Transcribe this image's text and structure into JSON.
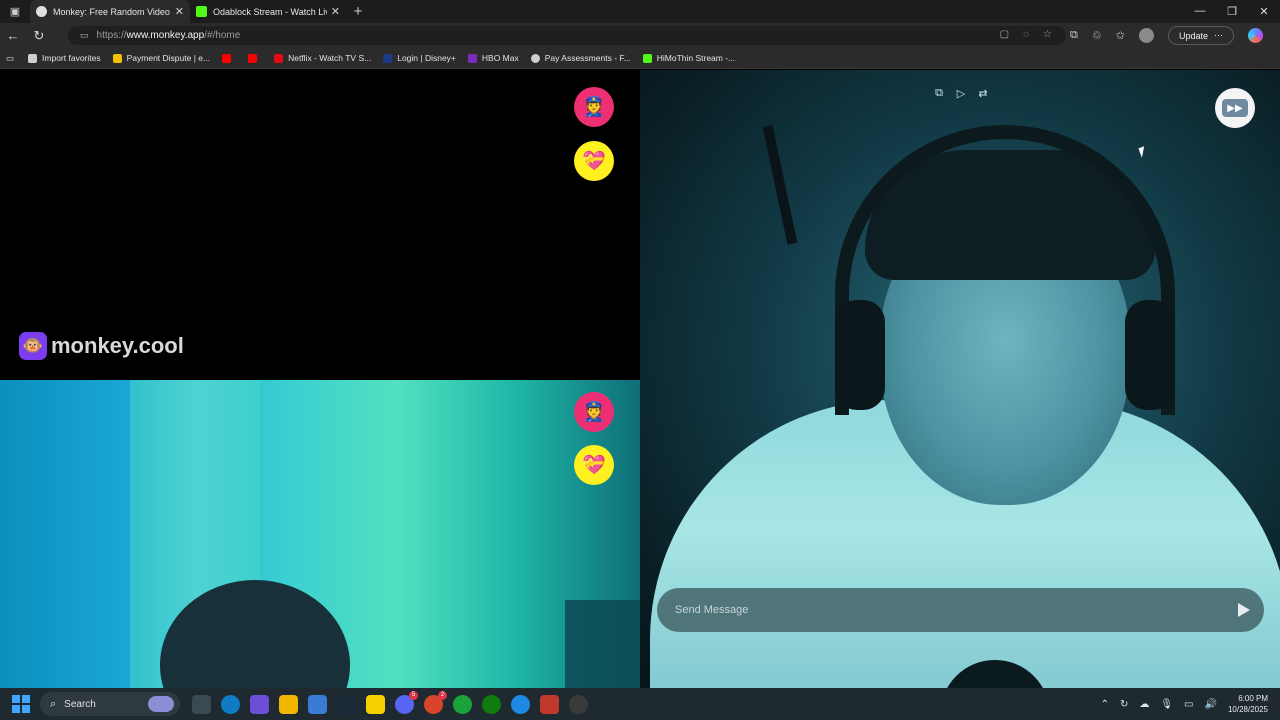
{
  "browser": {
    "tabs": [
      {
        "title": "Monkey: Free Random Video",
        "active": true,
        "favicon_color": "#e0e0e0"
      },
      {
        "title": "Odablock Stream - Watch Live on",
        "active": false,
        "favicon_color": "#53fc18"
      }
    ],
    "new_tab_label": "+",
    "window_controls": {
      "minimize": "—",
      "restore": "❐",
      "close": "✕"
    },
    "address": {
      "scheme": "https://",
      "host": "www.monkey.app",
      "path": "/#/home"
    },
    "update_label": "Update",
    "bookmarks": [
      {
        "label": "Import favorites",
        "color": "#cfcfcf"
      },
      {
        "label": "Payment Dispute | e...",
        "color": "#f2c200"
      },
      {
        "label": "",
        "color": "#ff0000"
      },
      {
        "label": "",
        "color": "#ff0000"
      },
      {
        "label": "Netflix - Watch TV S...",
        "color": "#e50914"
      },
      {
        "label": "Login | Disney+",
        "color": "#1a3a8a"
      },
      {
        "label": "HBO Max",
        "color": "#7b2cbf"
      },
      {
        "label": "Pay Assessments - F...",
        "color": "#cfcfcf"
      },
      {
        "label": "HiMoThin Stream -...",
        "color": "#53fc18"
      }
    ]
  },
  "page": {
    "brand_name": "monkey.cool",
    "brand_logo_icon": "🐵",
    "report_icon": "👮",
    "like_icon": "💝",
    "message_placeholder": "Send Message",
    "colors": {
      "report": "#ee2f74",
      "like": "#fff01f",
      "brand_logo": "#7c3cf0"
    }
  },
  "taskbar": {
    "search_label": "Search",
    "time": "6:00 PM",
    "date": "10/28/2025",
    "apps": [
      {
        "name": "task-view",
        "color": "#3b4a52",
        "badge": ""
      },
      {
        "name": "edge",
        "color": "#0f7ac6",
        "badge": ""
      },
      {
        "name": "copilot",
        "color": "#6b4fd8",
        "badge": ""
      },
      {
        "name": "file-explorer",
        "color": "#f2b600",
        "badge": ""
      },
      {
        "name": "store",
        "color": "#3a7bd5",
        "badge": ""
      },
      {
        "name": "steam",
        "color": "#1b2838",
        "badge": ""
      },
      {
        "name": "sticky-notes",
        "color": "#f7d000",
        "badge": ""
      },
      {
        "name": "discord",
        "color": "#5865f2",
        "badge": "5"
      },
      {
        "name": "game-app",
        "color": "#d8452a",
        "badge": "2"
      },
      {
        "name": "xbox-green",
        "color": "#1aa33a",
        "badge": ""
      },
      {
        "name": "xbox",
        "color": "#107c10",
        "badge": ""
      },
      {
        "name": "vscode",
        "color": "#1e88e5",
        "badge": ""
      },
      {
        "name": "snipping-tool",
        "color": "#c0392b",
        "badge": ""
      },
      {
        "name": "obs",
        "color": "#3a3a3a",
        "badge": ""
      }
    ]
  }
}
